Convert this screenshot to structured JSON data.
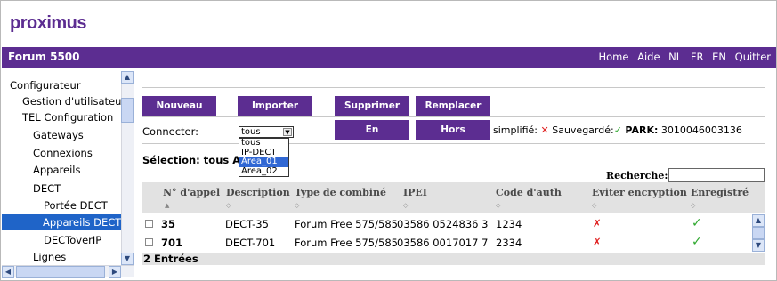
{
  "brand": {
    "logo": "proximus"
  },
  "header": {
    "title": "Forum 5500",
    "links": [
      "Home",
      "Aide",
      "NL",
      "FR",
      "EN",
      "Quitter"
    ]
  },
  "sidebar": {
    "items": [
      "Configurateur",
      "Gestion d'utilisateur",
      "TEL Configuration",
      "Gateways",
      "Connexions",
      "Appareils",
      "DECT",
      "Portée DECT",
      "Appareils DECT",
      "DECToverIP",
      "Lignes"
    ],
    "selected": "Appareils DECT"
  },
  "toolbar": {
    "buttons": [
      "Nouveau",
      "Importer",
      "Supprimer",
      "Remplacer"
    ]
  },
  "connect": {
    "label": "Connecter:",
    "value": "tous",
    "options": [
      "tous",
      "IP-DECT",
      "Area_01",
      "Area_02"
    ],
    "highlighted": "Area_01",
    "btn_on": "En",
    "btn_off": "Hors"
  },
  "status": {
    "simplified_label": "simplifié:",
    "saved_label": "Sauvegardé:",
    "park_label": "PARK:",
    "park_value": "3010046003136"
  },
  "selection": {
    "label": "Sélection:",
    "value": "tous",
    "cut": "Au"
  },
  "search": {
    "label": "Recherche:",
    "value": ""
  },
  "table": {
    "columns": [
      "N° d'appel",
      "Description",
      "Type de combiné",
      "IPEI",
      "Code d'auth",
      "Eviter encryption",
      "Enregistré"
    ],
    "rows": [
      {
        "number": "35",
        "description": "DECT-35",
        "type": "Forum Free 575/585",
        "ipei": "03586 0524836 3",
        "code": "1234",
        "avoid_encryption": "✗",
        "registered": "✓"
      },
      {
        "number": "701",
        "description": "DECT-701",
        "type": "Forum Free 575/585",
        "ipei": "03586 0017017 7",
        "code": "2334",
        "avoid_encryption": "✗",
        "registered": "✓"
      }
    ],
    "footer": "2 Entrées"
  },
  "colors": {
    "brand": "#5c2d91",
    "selection": "#1f64c8",
    "error": "#e02020",
    "success": "#2da82d"
  }
}
